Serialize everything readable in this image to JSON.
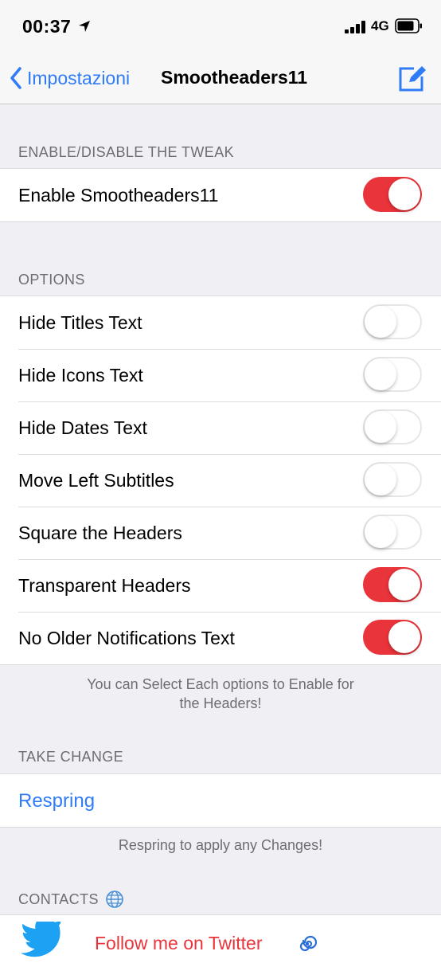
{
  "status_bar": {
    "time": "00:37",
    "network": "4G"
  },
  "nav": {
    "back_label": "Impostazioni",
    "title": "Smootheaders11"
  },
  "sections": {
    "enable": {
      "header": "ENABLE/DISABLE THE TWEAK",
      "rows": [
        {
          "label": "Enable Smootheaders11",
          "on": true
        }
      ]
    },
    "options": {
      "header": "OPTIONS",
      "rows": [
        {
          "label": "Hide Titles Text",
          "on": false
        },
        {
          "label": "Hide Icons Text",
          "on": false
        },
        {
          "label": "Hide Dates Text",
          "on": false
        },
        {
          "label": "Move Left Subtitles",
          "on": false
        },
        {
          "label": "Square the Headers",
          "on": false
        },
        {
          "label": "Transparent Headers",
          "on": true
        },
        {
          "label": "No Older Notifications Text",
          "on": true
        }
      ],
      "footer_line1": "You can Select Each options to Enable for",
      "footer_line2": "the Headers!"
    },
    "take_change": {
      "header": "TAKE CHANGE",
      "respring_label": "Respring",
      "footer": "Respring to apply any Changes!"
    },
    "contacts": {
      "header": "CONTACTS",
      "twitter_label": "Follow me on Twitter"
    }
  },
  "colors": {
    "accent_blue": "#2f7cf6",
    "toggle_on": "#e8343a",
    "twitter_blue": "#1da1f2"
  },
  "icons": [
    "location-arrow-icon",
    "signal-icon",
    "battery-icon",
    "back-chevron-icon",
    "compose-icon",
    "globe-icon",
    "twitter-bird-icon",
    "swirl-icon"
  ]
}
